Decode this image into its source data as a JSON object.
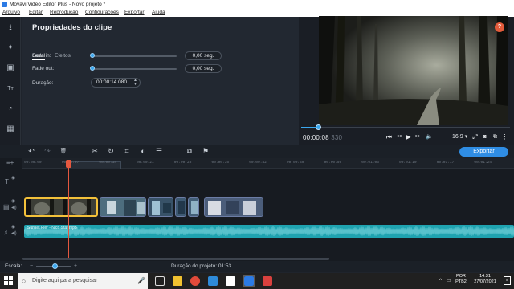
{
  "window": {
    "title": "Movavi Video Editor Plus - Novo projeto *"
  },
  "menu": {
    "items": [
      "Arquivo",
      "Editar",
      "Reprodução",
      "Configurações",
      "Exportar",
      "Ajuda"
    ]
  },
  "sidebar": {
    "items": [
      {
        "icon": "import-icon",
        "glyph": "⭳"
      },
      {
        "icon": "magic-wand-icon",
        "glyph": "✦"
      },
      {
        "icon": "filters-icon",
        "glyph": "▣"
      },
      {
        "icon": "titles-icon",
        "glyph": "Tт"
      },
      {
        "icon": "stickers-icon",
        "glyph": "◔"
      },
      {
        "icon": "more-tools-icon",
        "glyph": "▦"
      }
    ]
  },
  "properties": {
    "title": "Propriedades do clipe",
    "tabs": [
      {
        "label": "Geral",
        "active": true
      },
      {
        "label": "Efeitos",
        "active": false
      }
    ],
    "fade_in": {
      "label": "Fade in:",
      "value": "0,00 seg.",
      "level": 0
    },
    "fade_out": {
      "label": "Fade out:",
      "value": "0,00 seg.",
      "level": 0
    },
    "duration": {
      "label": "Duração:",
      "value": "00:00:14.080"
    }
  },
  "preview": {
    "help_label": "?",
    "progress_fraction": 0.08,
    "timecode_main": "00:00:08",
    "timecode_frames": "330",
    "aspect": "16:9 ▾",
    "playback_buttons": [
      {
        "name": "previous-icon",
        "glyph": "⏮"
      },
      {
        "name": "step-back-icon",
        "glyph": "◂◂"
      },
      {
        "name": "play-icon",
        "glyph": "▶"
      },
      {
        "name": "step-forward-icon",
        "glyph": "▸▸"
      },
      {
        "name": "volume-icon",
        "glyph": "🔈"
      }
    ]
  },
  "toolbar": {
    "export_label": "Exportar",
    "buttons": [
      {
        "name": "undo-icon",
        "glyph": "↶"
      },
      {
        "name": "redo-icon",
        "glyph": "↷"
      },
      {
        "name": "delete-icon",
        "glyph": "🗑"
      },
      {
        "name": "split-icon",
        "glyph": "✂"
      },
      {
        "name": "rotate-icon",
        "glyph": "↻"
      },
      {
        "name": "crop-icon",
        "glyph": "⌗"
      },
      {
        "name": "color-icon",
        "glyph": "◐"
      },
      {
        "name": "clip-properties-icon",
        "glyph": "☰"
      },
      {
        "name": "transition-icon",
        "glyph": "⧉"
      },
      {
        "name": "marker-icon",
        "glyph": "⚑"
      }
    ]
  },
  "timeline": {
    "ruler_labels": [
      "00:00:00",
      "00:00:07",
      "00:00:14",
      "00:00:21",
      "00:00:28",
      "00:00:35",
      "00:00:42",
      "00:00:49",
      "00:00:56",
      "00:01:03",
      "00:01:10",
      "00:01:17",
      "00:01:24"
    ],
    "audio_label": "Sunset Pier - Nico Staf mp3"
  },
  "status": {
    "scale_label": "Escala:",
    "project_duration": "Duração do projeto:  01:53"
  },
  "taskbar": {
    "search_placeholder": "Digite aqui para pesquisar",
    "lang_top": "POR",
    "lang_bottom": "PTB2",
    "time": "14:31",
    "date": "27/07/2021"
  },
  "colors": {
    "accent": "#2f8de4",
    "playhead": "#e5583f",
    "audio": "#1fa3b0",
    "selected_clip": "#f3c13a"
  }
}
